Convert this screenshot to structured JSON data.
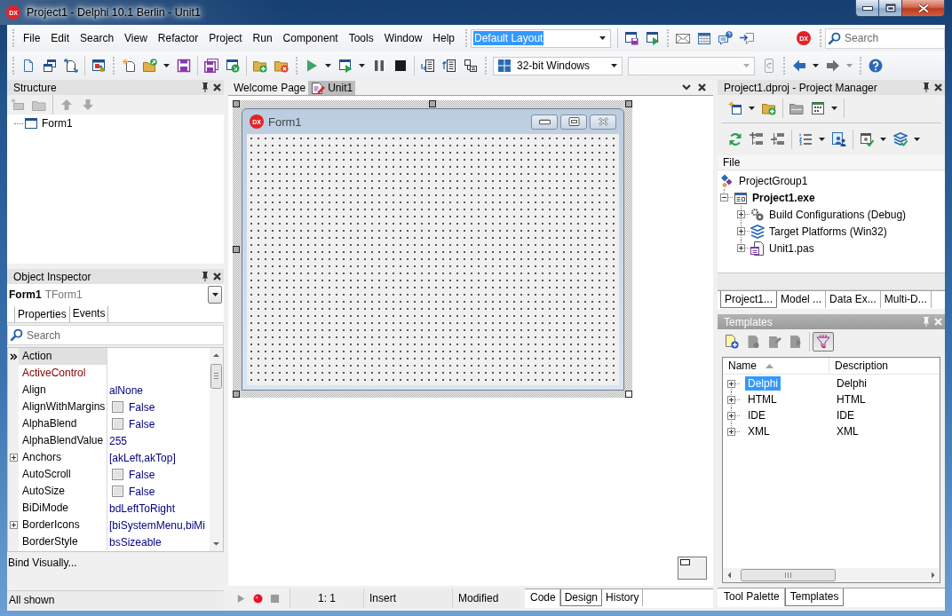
{
  "window": {
    "logo": "DX",
    "title": "Project1 - Delphi 10.1 Berlin - Unit1"
  },
  "menu": [
    "File",
    "Edit",
    "Search",
    "View",
    "Refactor",
    "Project",
    "Run",
    "Component",
    "Tools",
    "Window",
    "Help"
  ],
  "layout_combo": {
    "value": "Default Layout",
    "highlighted": true
  },
  "toolbar_logo": "DX",
  "search": {
    "placeholder": "Search"
  },
  "platform_combo": {
    "value": "32-bit Windows"
  },
  "device_combo": {
    "disabled": true
  },
  "structure": {
    "title": "Structure",
    "active": false,
    "tree": [
      {
        "label": "Form1"
      }
    ]
  },
  "object_inspector": {
    "title": "Object Inspector",
    "active": false,
    "object": "Form1",
    "class": "TForm1",
    "tabs": [
      {
        "label": "Properties",
        "selected": true
      },
      {
        "label": "Events",
        "selected": false
      }
    ],
    "search": {
      "placeholder": "Search"
    },
    "properties": [
      {
        "name": "Action",
        "kind": "text",
        "selected": true
      },
      {
        "name": "ActiveControl",
        "kind": "component",
        "selected": false
      },
      {
        "name": "Align",
        "kind": "text",
        "value": "alNone",
        "selected": false
      },
      {
        "name": "AlignWithMargins",
        "kind": "bool",
        "value": "False",
        "checked": false,
        "selected": false
      },
      {
        "name": "AlphaBlend",
        "kind": "bool",
        "value": "False",
        "checked": false,
        "selected": false
      },
      {
        "name": "AlphaBlendValue",
        "kind": "text",
        "value": "255",
        "selected": false
      },
      {
        "name": "Anchors",
        "kind": "text",
        "value": "[akLeft,akTop]",
        "expanded": false,
        "selected": false
      },
      {
        "name": "AutoScroll",
        "kind": "bool",
        "value": "False",
        "checked": false,
        "selected": false
      },
      {
        "name": "AutoSize",
        "kind": "bool",
        "value": "False",
        "checked": false,
        "selected": false
      },
      {
        "name": "BiDiMode",
        "kind": "text",
        "value": "bdLeftToRight",
        "selected": false
      },
      {
        "name": "BorderIcons",
        "kind": "text",
        "value": "[biSystemMenu,biMi",
        "expanded": false,
        "selected": false
      },
      {
        "name": "BorderStyle",
        "kind": "text",
        "value": "bsSizeable",
        "selected": false
      }
    ],
    "link": "Bind Visually...",
    "status": "All shown"
  },
  "editor": {
    "tabs": [
      {
        "label": "Welcome Page",
        "kind": "page",
        "selected": false
      },
      {
        "label": "Unit1",
        "kind": "unit",
        "selected": true
      }
    ],
    "form": {
      "logo": "DX",
      "title": "Form1"
    },
    "status": {
      "position": "1: 1",
      "mode": "Insert",
      "state": "Modified"
    },
    "view_tabs": [
      {
        "label": "Code",
        "selected": false
      },
      {
        "label": "Design",
        "selected": true
      },
      {
        "label": "History",
        "selected": false
      }
    ]
  },
  "project_manager": {
    "title": "Project1.dproj - Project Manager",
    "active": false,
    "column": "File",
    "tree": [
      {
        "label": "ProjectGroup1",
        "kind": "group",
        "active": false,
        "children": [
          {
            "label": "Project1.exe",
            "kind": "project",
            "active": true,
            "expanded": true,
            "children": [
              {
                "label": "Build Configurations (Debug)",
                "kind": "configurations",
                "active": false,
                "expanded": false
              },
              {
                "label": "Target Platforms (Win32)",
                "kind": "platforms",
                "active": false,
                "expanded": false
              },
              {
                "label": "Unit1.pas",
                "kind": "unit",
                "active": false,
                "expanded": false
              }
            ]
          }
        ]
      }
    ],
    "tabs": [
      {
        "label": "Project1...",
        "selected": true
      },
      {
        "label": "Model ...",
        "selected": false
      },
      {
        "label": "Data Ex...",
        "selected": false
      },
      {
        "label": "Multi-D...",
        "selected": false
      }
    ]
  },
  "templates": {
    "title": "Templates",
    "active": true,
    "filter_on": true,
    "columns": [
      {
        "label": "Name",
        "sorted": true
      },
      {
        "label": "Description",
        "sorted": false
      }
    ],
    "rows": [
      {
        "name": "Delphi",
        "description": "Delphi",
        "expanded": false,
        "selected": true
      },
      {
        "name": "HTML",
        "description": "HTML",
        "expanded": false,
        "selected": false
      },
      {
        "name": "IDE",
        "description": "IDE",
        "expanded": false,
        "selected": false
      },
      {
        "name": "XML",
        "description": "XML",
        "expanded": false,
        "selected": false
      }
    ]
  },
  "dock_tabs": [
    {
      "label": "Tool Palette",
      "selected": false
    },
    {
      "label": "Templates",
      "selected": true
    }
  ]
}
